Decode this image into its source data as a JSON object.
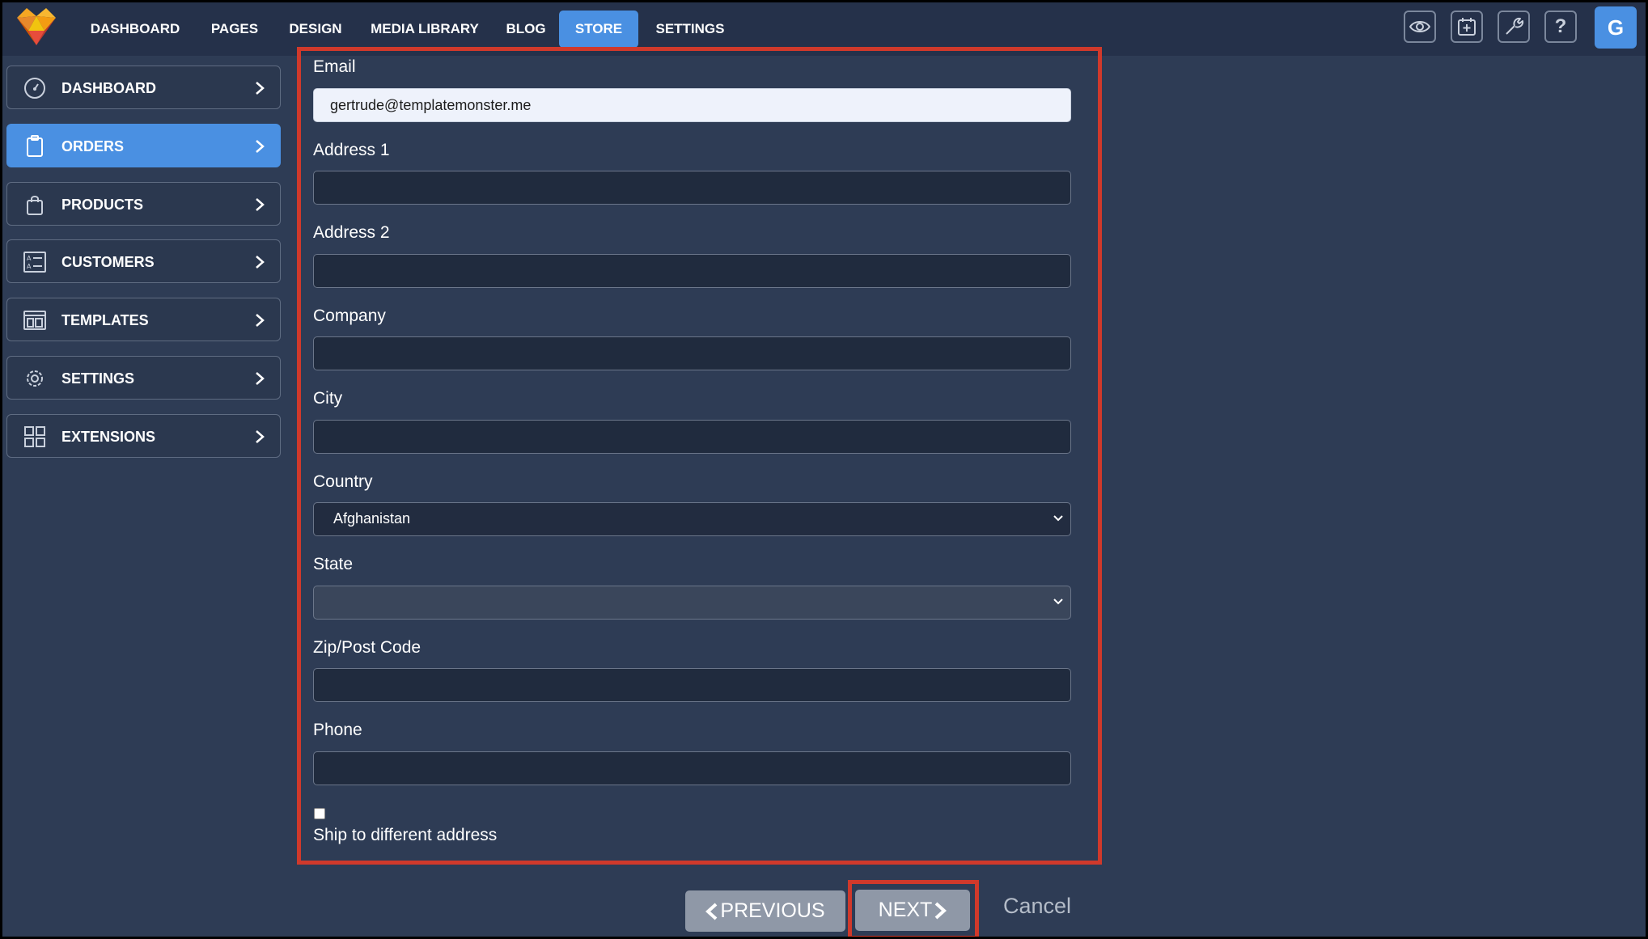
{
  "topnav": {
    "items": [
      "DASHBOARD",
      "PAGES",
      "DESIGN",
      "MEDIA LIBRARY",
      "BLOG",
      "STORE",
      "SETTINGS"
    ],
    "active": "STORE",
    "avatar_letter": "G"
  },
  "sidebar": {
    "items": [
      {
        "label": "DASHBOARD",
        "icon": "gauge-icon"
      },
      {
        "label": "ORDERS",
        "icon": "clipboard-icon",
        "active": true
      },
      {
        "label": "PRODUCTS",
        "icon": "shopping-bag-icon"
      },
      {
        "label": "CUSTOMERS",
        "icon": "contacts-card-icon"
      },
      {
        "label": "TEMPLATES",
        "icon": "template-layout-icon"
      },
      {
        "label": "SETTINGS",
        "icon": "gear-icon"
      },
      {
        "label": "EXTENSIONS",
        "icon": "grid-blocks-icon"
      }
    ]
  },
  "form": {
    "email": {
      "label": "Email",
      "value": "gertrude@templatemonster.me"
    },
    "address1": {
      "label": "Address 1",
      "value": ""
    },
    "address2": {
      "label": "Address 2",
      "value": ""
    },
    "company": {
      "label": "Company",
      "value": ""
    },
    "city": {
      "label": "City",
      "value": ""
    },
    "country": {
      "label": "Country",
      "value": "Afghanistan"
    },
    "state": {
      "label": "State",
      "value": ""
    },
    "zip": {
      "label": "Zip/Post Code",
      "value": ""
    },
    "phone": {
      "label": "Phone",
      "value": ""
    },
    "ship_different": {
      "label": "Ship to different address",
      "checked": false
    }
  },
  "actions": {
    "previous": "PREVIOUS",
    "next": "NEXT",
    "cancel": "Cancel"
  },
  "colors": {
    "accent": "#4a90e2",
    "highlight": "#d0392b",
    "background": "#2e3c55"
  }
}
